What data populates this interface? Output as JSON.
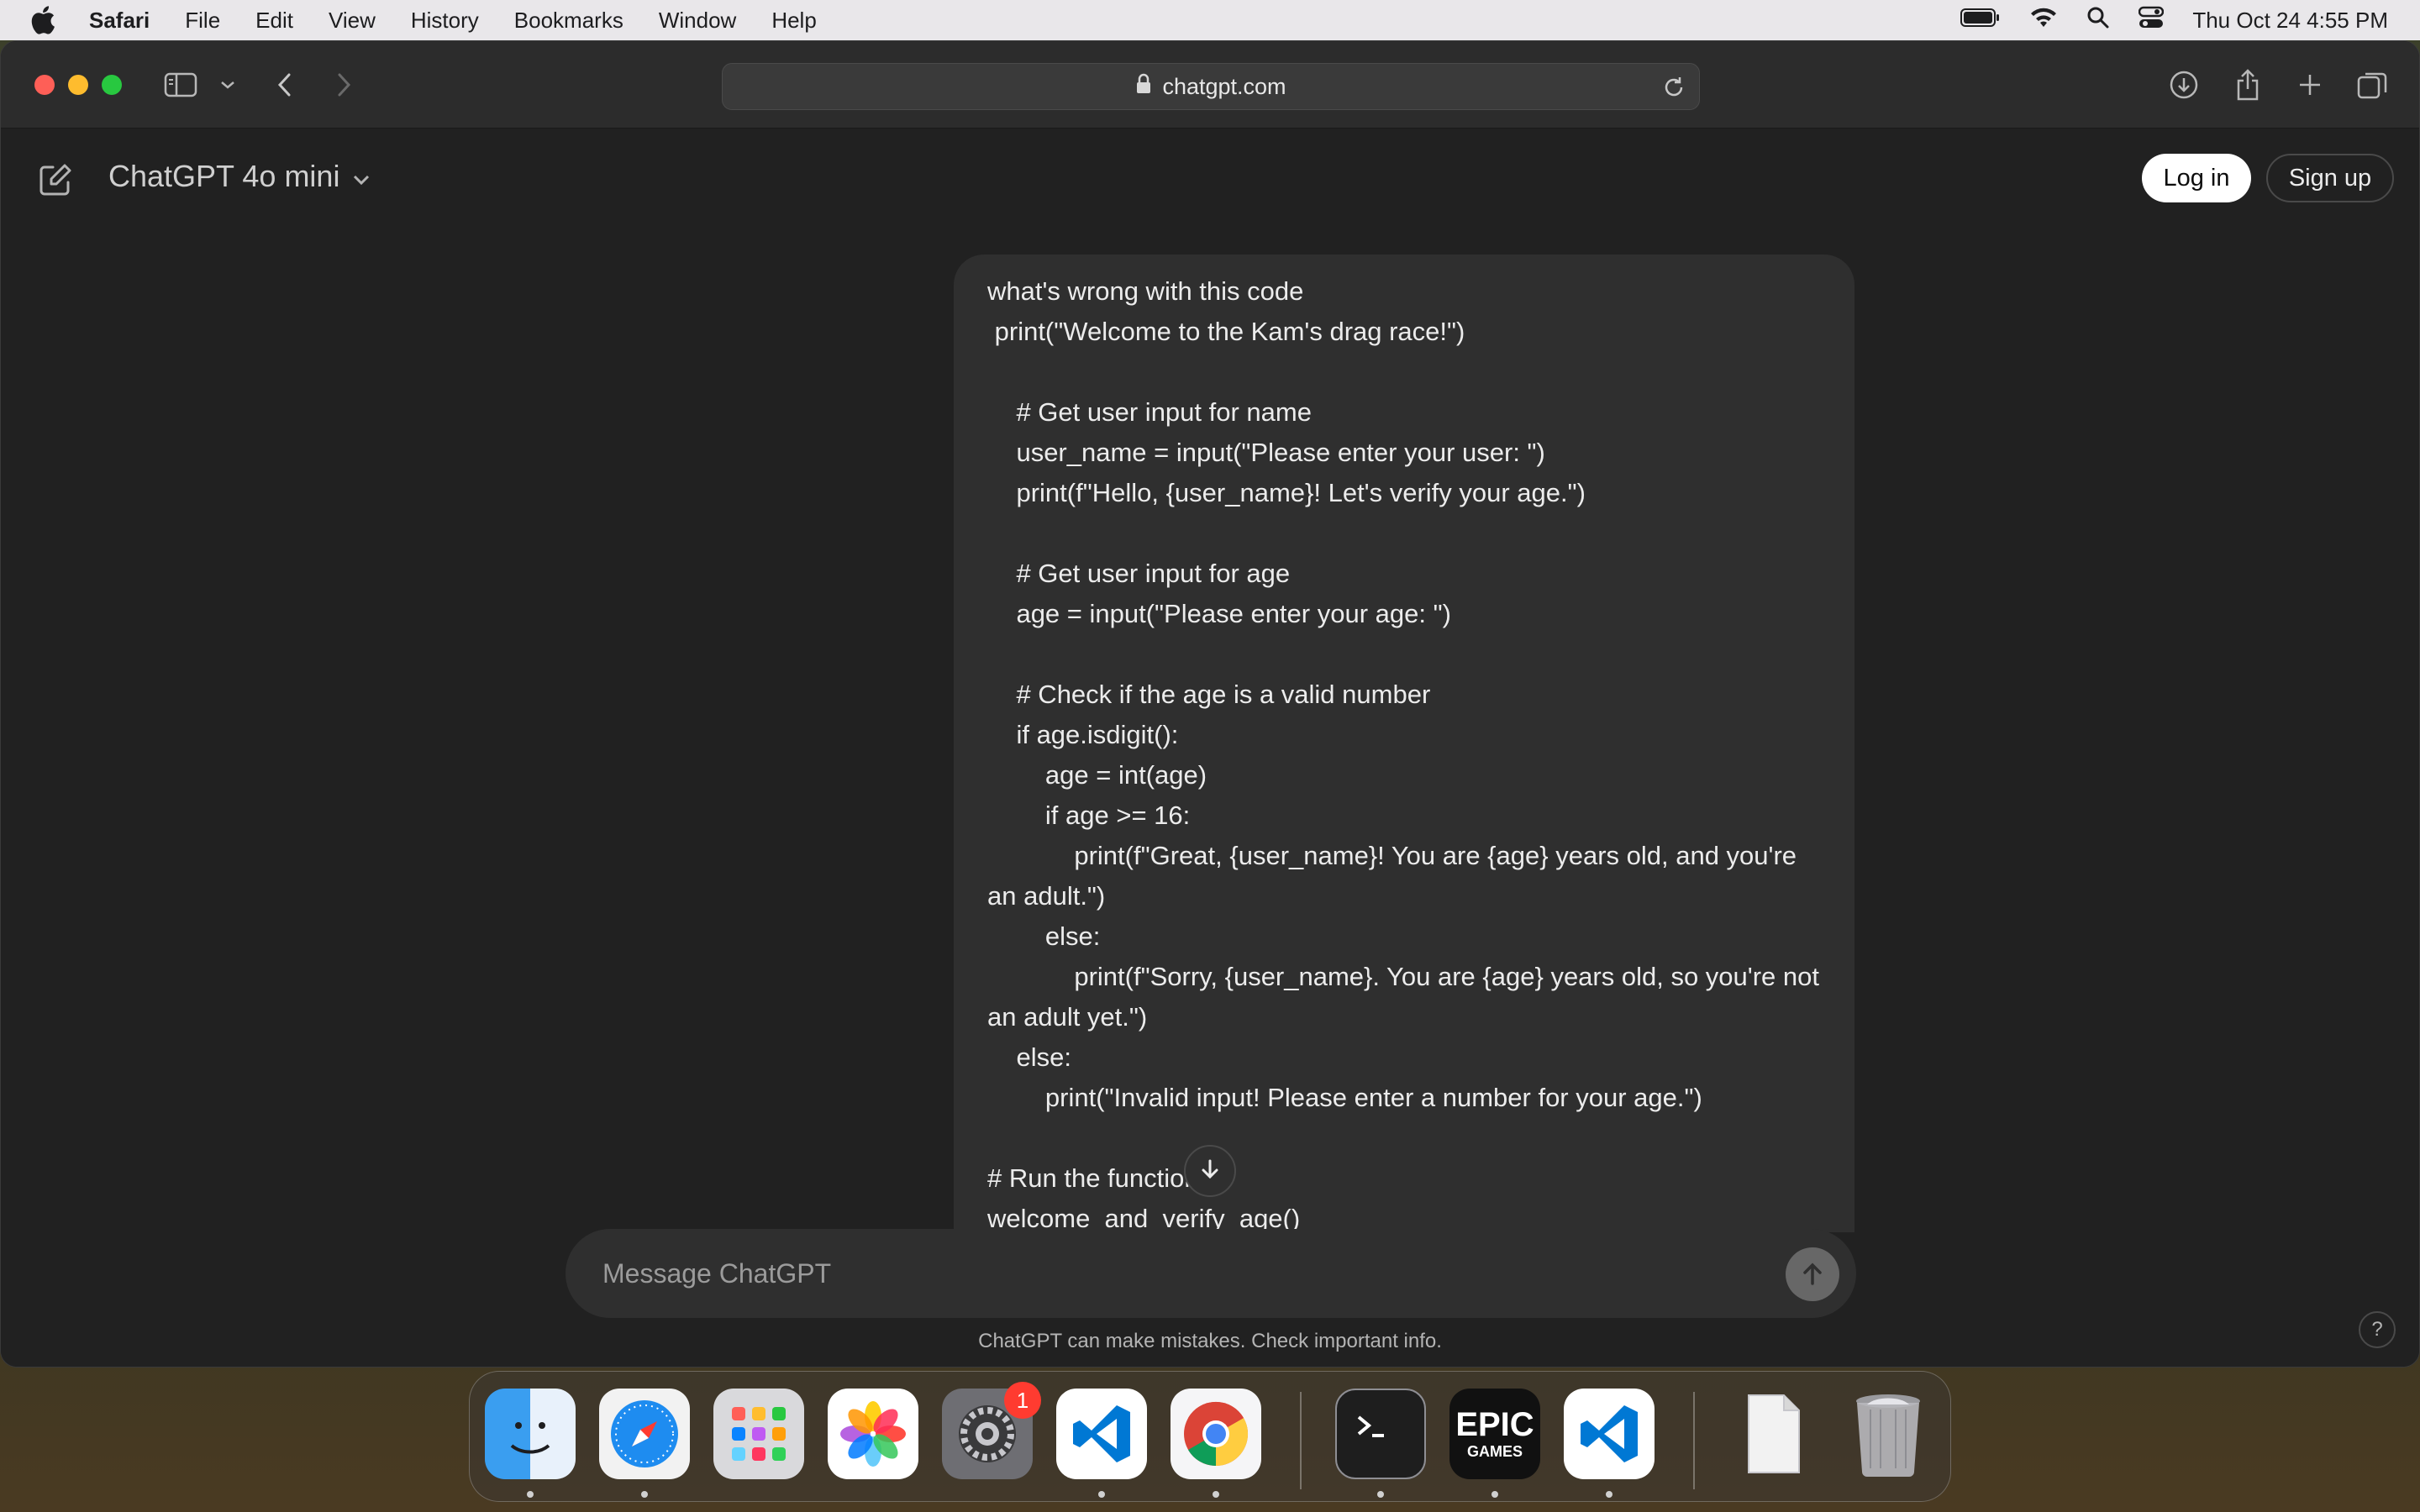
{
  "menubar": {
    "app_name": "Safari",
    "items": [
      "File",
      "Edit",
      "View",
      "History",
      "Bookmarks",
      "Window",
      "Help"
    ],
    "clock": "Thu Oct 24  4:55 PM"
  },
  "browser": {
    "url": "chatgpt.com"
  },
  "header": {
    "model_title": "ChatGPT 4o mini",
    "login_label": "Log in",
    "signup_label": "Sign up"
  },
  "conversation": {
    "user_message": "what's wrong with this code\n print(\"Welcome to the Kam's drag race!\")\n\n    # Get user input for name\n    user_name = input(\"Please enter your user: \")\n    print(f\"Hello, {user_name}! Let's verify your age.\")\n\n    # Get user input for age\n    age = input(\"Please enter your age: \")\n\n    # Check if the age is a valid number\n    if age.isdigit():\n        age = int(age)\n        if age >= 16:\n            print(f\"Great, {user_name}! You are {age} years old, and you're an adult.\")\n        else:\n            print(f\"Sorry, {user_name}. You are {age} years old, so you're not an adult yet.\")\n    else:\n        print(\"Invalid input! Please enter a number for your age.\")\n\n# Run the function\nwelcome_and_verify_age()"
  },
  "composer": {
    "placeholder": "Message ChatGPT"
  },
  "footer": {
    "disclaimer": "ChatGPT can make mistakes. Check important info.",
    "help_label": "?"
  },
  "dock": {
    "settings_badge": "1",
    "epic_label_top": "EPIC",
    "epic_label_bottom": "GAMES"
  },
  "colors": {
    "accent_white": "#ffffff",
    "page_bg": "#212121",
    "bubble_bg": "#2f2f2f"
  }
}
